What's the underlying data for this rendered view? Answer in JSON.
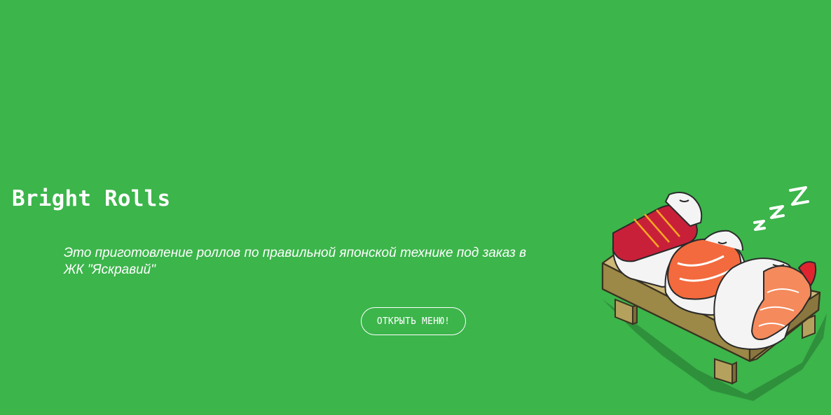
{
  "hero": {
    "title": "Bright Rolls",
    "tagline": "Это приготовление роллов по правильной японской технике под заказ в ЖК \"Яскравий\"",
    "cta_label": "ОТКРЫТЬ МЕНЮ!",
    "illustration": {
      "name": "sleeping-sushi-icon",
      "zzz_text": "ZZZ"
    }
  },
  "colors": {
    "background": "#3cb54b",
    "text": "#ffffff",
    "board": "#b5a15e",
    "tuna": "#c9203a",
    "salmon": "#f26a3d",
    "shrimp": "#f58a5c",
    "rice": "#f4f4f4"
  }
}
